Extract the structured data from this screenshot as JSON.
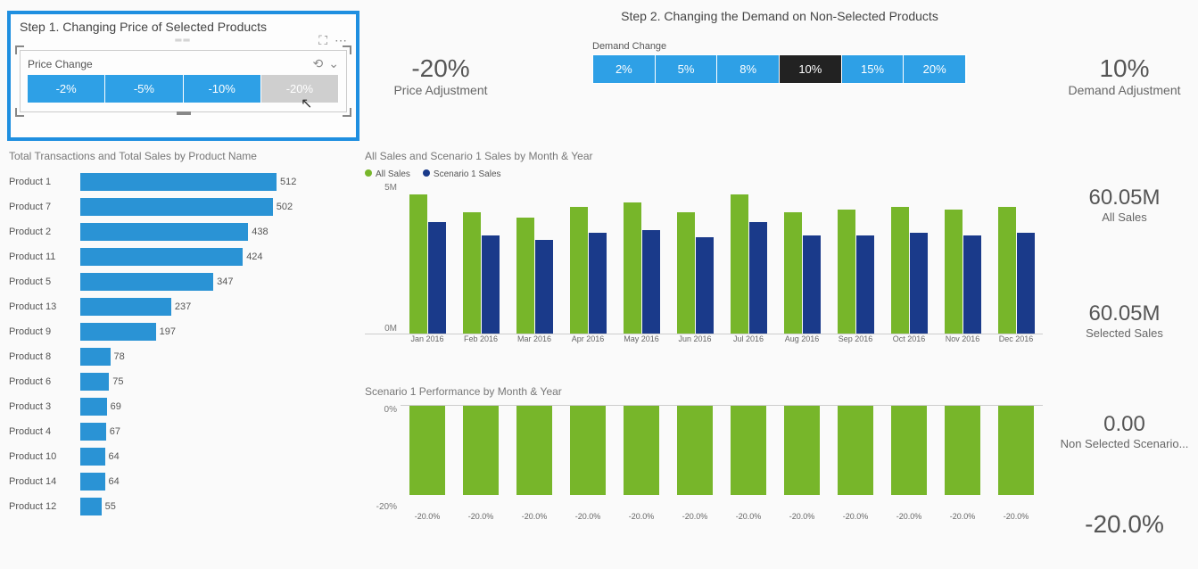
{
  "step1": {
    "title": "Step 1. Changing Price of Selected Products",
    "slicer_label": "Price Change",
    "options": [
      "-2%",
      "-5%",
      "-10%",
      "-20%"
    ],
    "selected_index_dim": 3
  },
  "price_adj_kpi": {
    "value": "-20%",
    "label": "Price Adjustment"
  },
  "step2": {
    "title": "Step 2. Changing the Demand on Non-Selected Products",
    "slicer_label": "Demand Change",
    "options": [
      "2%",
      "5%",
      "8%",
      "10%",
      "15%",
      "20%"
    ],
    "selected_index": 3
  },
  "demand_adj_kpi": {
    "value": "10%",
    "label": "Demand Adjustment"
  },
  "product_chart_title": "Total Transactions and Total Sales by Product Name",
  "sales_chart_title": "All Sales and Scenario 1 Sales by Month & Year",
  "scenario_chart_title": "Scenario 1 Performance by Month & Year",
  "legend": {
    "a": "All Sales",
    "b": "Scenario 1 Sales"
  },
  "yaxis_top": "5M",
  "yaxis_bot": "0M",
  "yaxis2_top": "0%",
  "yaxis2_bot": "-20%",
  "kpi_allsales": {
    "value": "60.05M",
    "label": "All Sales"
  },
  "kpi_selected": {
    "value": "60.05M",
    "label": "Selected Sales"
  },
  "kpi_nonsel": {
    "value": "0.00",
    "label": "Non Selected Scenario..."
  },
  "kpi_perf": {
    "value": "-20.0%"
  },
  "chart_data": [
    {
      "type": "bar",
      "title": "Total Transactions and Total Sales by Product Name",
      "orientation": "horizontal",
      "categories": [
        "Product 1",
        "Product 7",
        "Product 2",
        "Product 11",
        "Product 5",
        "Product 13",
        "Product 9",
        "Product 8",
        "Product 6",
        "Product 3",
        "Product 4",
        "Product 10",
        "Product 14",
        "Product 12"
      ],
      "values": [
        512,
        502,
        438,
        424,
        347,
        237,
        197,
        78,
        75,
        69,
        67,
        64,
        64,
        55
      ],
      "xlabel": "",
      "ylabel": ""
    },
    {
      "type": "bar",
      "title": "All Sales and Scenario 1 Sales by Month & Year",
      "categories": [
        "Jan 2016",
        "Feb 2016",
        "Mar 2016",
        "Apr 2016",
        "May 2016",
        "Jun 2016",
        "Jul 2016",
        "Aug 2016",
        "Sep 2016",
        "Oct 2016",
        "Nov 2016",
        "Dec 2016"
      ],
      "series": [
        {
          "name": "All Sales",
          "values": [
            5.5,
            4.8,
            4.6,
            5.0,
            5.2,
            4.8,
            5.5,
            4.8,
            4.9,
            5.0,
            4.9,
            5.0
          ]
        },
        {
          "name": "Scenario 1 Sales",
          "values": [
            4.4,
            3.9,
            3.7,
            4.0,
            4.1,
            3.8,
            4.4,
            3.9,
            3.9,
            4.0,
            3.9,
            4.0
          ]
        }
      ],
      "ylabel": "M",
      "ylim": [
        0,
        6
      ]
    },
    {
      "type": "bar",
      "title": "Scenario 1 Performance by Month & Year",
      "categories": [
        "Jan 2016",
        "Feb 2016",
        "Mar 2016",
        "Apr 2016",
        "May 2016",
        "Jun 2016",
        "Jul 2016",
        "Aug 2016",
        "Sep 2016",
        "Oct 2016",
        "Nov 2016",
        "Dec 2016"
      ],
      "values": [
        -20.0,
        -20.0,
        -20.0,
        -20.0,
        -20.0,
        -20.0,
        -20.0,
        -20.0,
        -20.0,
        -20.0,
        -20.0,
        -20.0
      ],
      "data_labels": [
        "-20.0%",
        "-20.0%",
        "-20.0%",
        "-20.0%",
        "-20.0%",
        "-20.0%",
        "-20.0%",
        "-20.0%",
        "-20.0%",
        "-20.0%",
        "-20.0%",
        "-20.0%"
      ],
      "ylim": [
        -22,
        0
      ],
      "ylabel": "%"
    }
  ]
}
